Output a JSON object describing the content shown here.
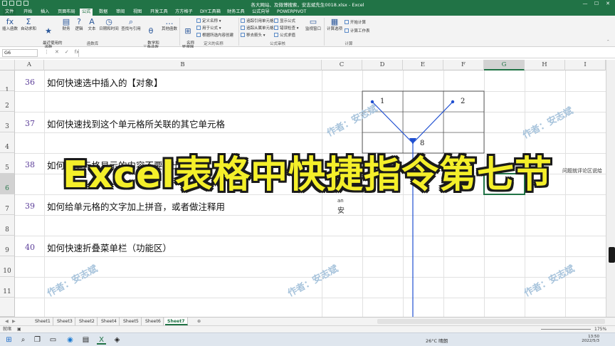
{
  "window": {
    "title": "各大网站、及微博搜索，安志斌先生0018.xlsx - Excel",
    "controls": [
      "—",
      "☐",
      "✕"
    ]
  },
  "tabs": [
    "文件",
    "开始",
    "插入",
    "页面布局",
    "公式",
    "数据",
    "审阅",
    "视图",
    "开发工具",
    "方方格子",
    "DIY工具箱",
    "财务工具",
    "公式向导",
    "POWERPIVOT"
  ],
  "active_tab": "公式",
  "ribbon": {
    "buttons": [
      {
        "label": "插入函数",
        "icon": "fx"
      },
      {
        "label": "自动求和",
        "icon": "Σ"
      },
      {
        "label": "最近使用的\n函数",
        "icon": "★"
      },
      {
        "label": "财务",
        "icon": "▤"
      },
      {
        "label": "逻辑",
        "icon": "?"
      },
      {
        "label": "文本",
        "icon": "A"
      },
      {
        "label": "日期和时间",
        "icon": "◷"
      },
      {
        "label": "查找与引用",
        "icon": "⌕"
      },
      {
        "label": "数学和\n三角函数",
        "icon": "θ"
      },
      {
        "label": "其他函数",
        "icon": "…"
      }
    ],
    "group_function_library": "函数库",
    "name_manager": "名称\n管理器",
    "define_names": [
      "定义名称 ▾",
      "用于公式 ▾",
      "根据所选内容创建"
    ],
    "group_defined_names": "定义的名称",
    "auditing": [
      "追踪引用单元格",
      "追踪从属单元格",
      "移去箭头 ▾",
      "显示公式",
      "错误检查 ▾",
      "公式求值"
    ],
    "watch_window": "监视窗口",
    "group_formula_auditing": "公式审核",
    "calc_options": "计算选项",
    "calc_now": "开始计算",
    "calc_sheet": "计算工作表",
    "group_calculation": "计算"
  },
  "formula_bar": {
    "name_box": "G6",
    "buttons": [
      "⋮",
      "✕",
      "✓",
      "fx"
    ]
  },
  "columns": [
    "A",
    "B",
    "C",
    "D",
    "E",
    "F",
    "G",
    "H",
    "I"
  ],
  "selected_column": "G",
  "rows": [
    "1",
    "2",
    "3",
    "4",
    "5",
    "6",
    "7",
    "8",
    "9",
    "10",
    "11"
  ],
  "selected_row": "6",
  "items": [
    {
      "num": "36",
      "text": "如何快速选中插入的【对象】"
    },
    {
      "num": "37",
      "text": "如何快速找到这个单元格所关联的其它单元格"
    },
    {
      "num": "38",
      "text": "如何让单元格显示的内容不要溢出"
    },
    {
      "num": "39",
      "text": "如何给单元格的文字加上拼音，或者做注释用"
    },
    {
      "num": "40",
      "text": "如何快速折叠菜单栏（功能区）"
    }
  ],
  "diagram": {
    "n1": "1",
    "n2": "2",
    "n8": "8"
  },
  "phonetic": {
    "pinyin": "an",
    "char": "安"
  },
  "overflow_text": "问题就评论区说给",
  "watermark": "作者：安志斌",
  "sheets": [
    "Sheet1",
    "Sheet3",
    "Sheet2",
    "Sheet4",
    "Sheet5",
    "Sheet6",
    "Sheet7"
  ],
  "active_sheet": "Sheet7",
  "status": {
    "ready": "就绪",
    "zoom": "175%"
  },
  "taskbar": {
    "weather": "26°C 晴朗",
    "time": "13:50",
    "date": "2022/5/3"
  },
  "overlay_title": "Excel表格中快捷指令第七节",
  "colors": {
    "excel_green": "#217346",
    "banner_yellow": "#f4ef2a",
    "arrow_blue": "#1f4fd1"
  }
}
